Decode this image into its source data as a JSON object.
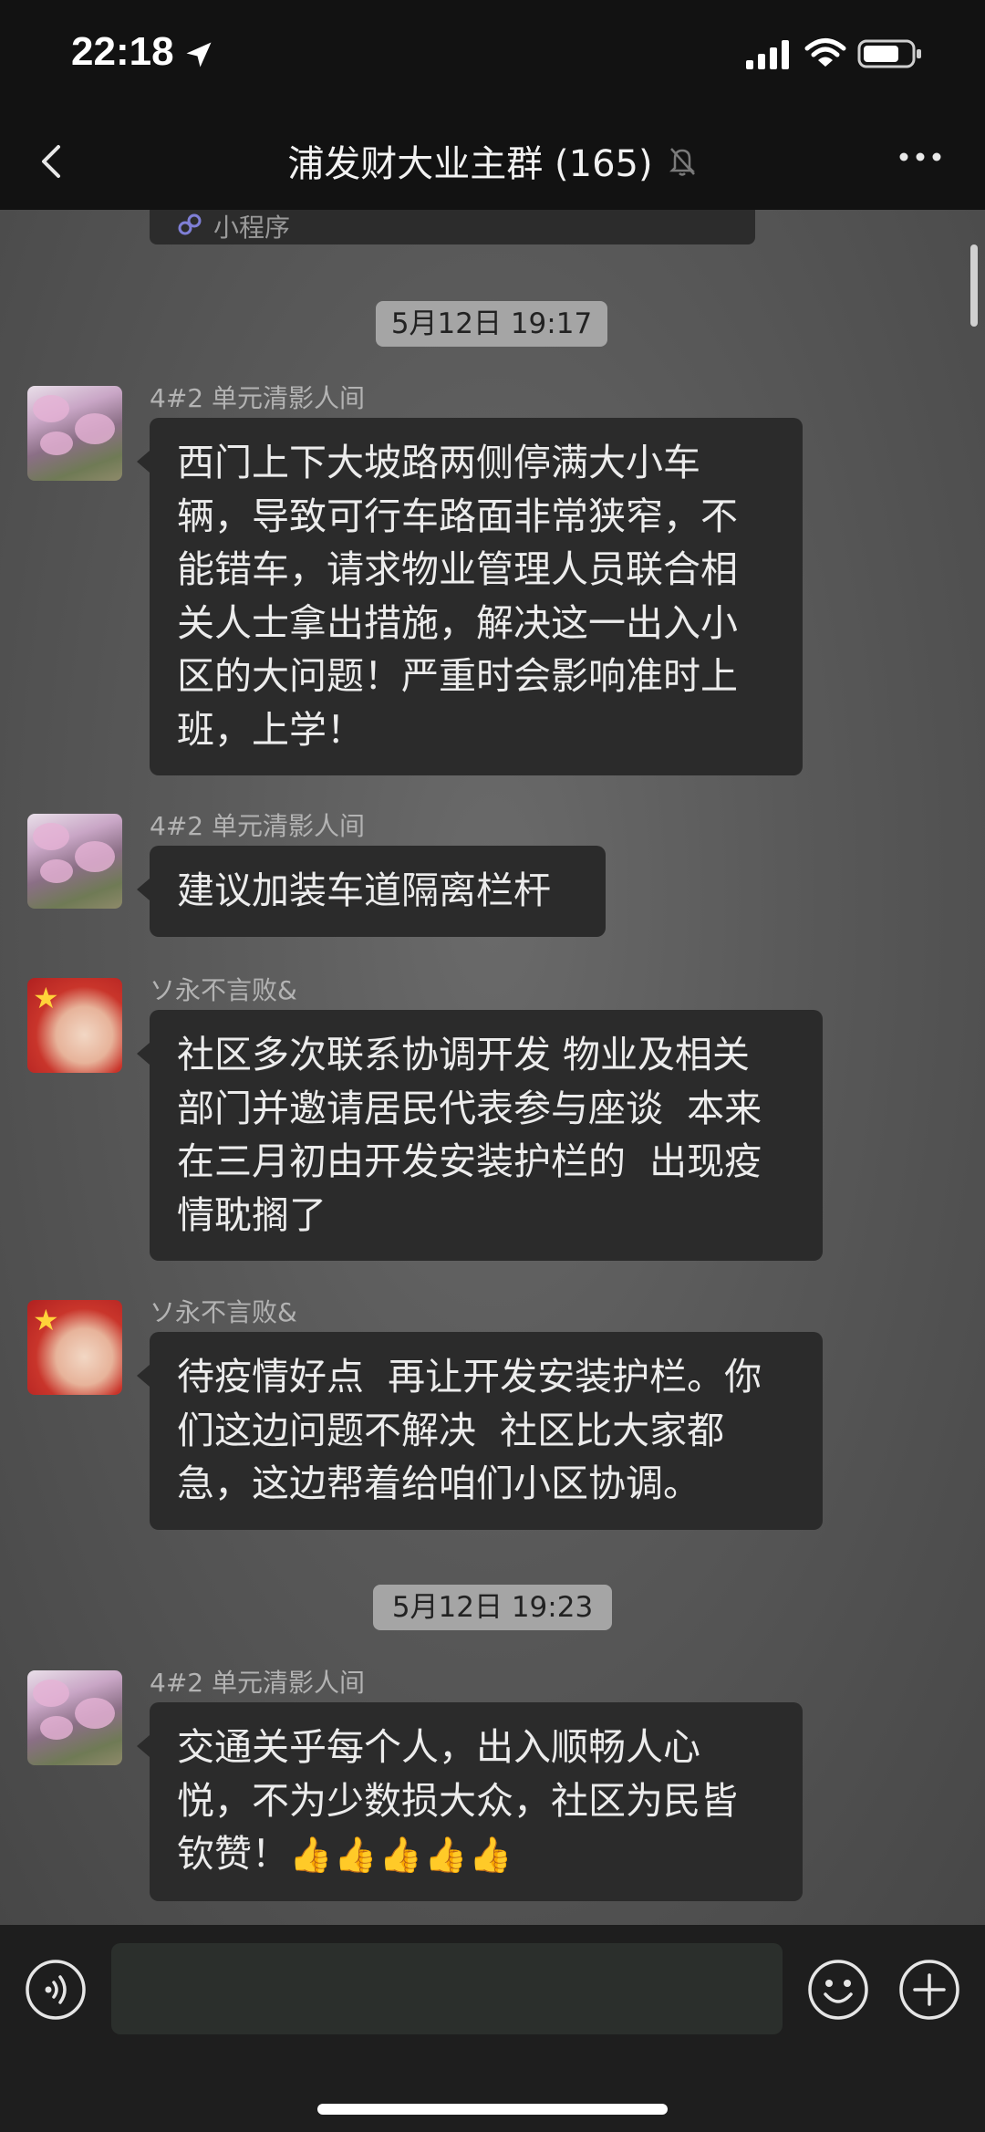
{
  "status_bar": {
    "time": "22:18"
  },
  "header": {
    "title": "浦发财大业主群 (165)"
  },
  "mini_program": {
    "label": "小程序"
  },
  "timestamps": [
    "5月12日 19:17",
    "5月12日 19:23"
  ],
  "messages": [
    {
      "sender": "4#2 单元清影人间",
      "text": "西门上下大坡路两侧停满大小车\n辆，导致可行车路面非常狭窄，不\n能错车，请求物业管理人员联合相\n关人士拿出措施，解决这一出入小\n区的大问题！严重时会影响准时上\n班，上学！"
    },
    {
      "sender": "4#2 单元清影人间",
      "text": "建议加装车道隔离栏杆"
    },
    {
      "sender": "ソ永不言败&",
      "text": "社区多次联系协调开发 物业及相关\n部门并邀请居民代表参与座谈  本来\n在三月初由开发安装护栏的  出现疫\n情耽搁了"
    },
    {
      "sender": "ソ永不言败&",
      "text": "待疫情好点  再让开发安装护栏。你\n们这边问题不解决  社区比大家都\n急，这边帮着给咱们小区协调。"
    },
    {
      "sender": "4#2 单元清影人间",
      "text": "交通关乎每个人，出入顺畅人心\n悦，不为少数损大众，社区为民皆\n钦赞！",
      "emoji": "👍👍👍👍👍"
    }
  ],
  "input": {
    "value": ""
  },
  "colors": {
    "bubble": "#2b2b2b",
    "chat_bg": "#595959",
    "timestamp_bg": "#a5a5a5",
    "bar_bg": "#121212"
  }
}
